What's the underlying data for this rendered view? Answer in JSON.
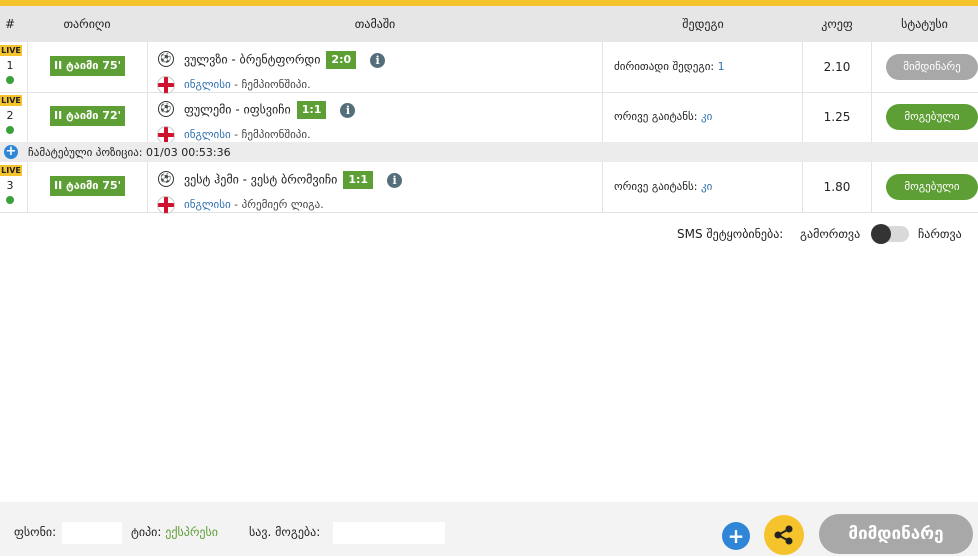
{
  "colors": {
    "accent_yellow": "#f5c32c",
    "badge_green": "#5d9e35",
    "status_grey": "#a8a8a8",
    "link_blue": "#2f6fb0",
    "plus_blue": "#2f86d6"
  },
  "header": {
    "col_num": "#",
    "col_date": "თარიღი",
    "col_match": "თამაში",
    "col_result": "შედეგი",
    "col_coef": "კოეფ",
    "col_status": "სტატუსი"
  },
  "rows": [
    {
      "live": "LIVE",
      "num": "1",
      "time": "II ტაიმი 75'",
      "teams": "ვულვზი - ბრენტფორდი",
      "score": "2:0",
      "country": "ინგლისი",
      "league": " - ჩემპიონშიპი.",
      "result_label": "ძირითადი შედეგი: ",
      "result_value": "1",
      "coef": "2.10",
      "status": "მიმდინარე",
      "status_color": "grey"
    },
    {
      "live": "LIVE",
      "num": "2",
      "time": "II ტაიმი 72'",
      "teams": "ფულემი - იფსვიჩი",
      "score": "1:1",
      "country": "ინგლისი",
      "league": " - ჩემპიონშიპი.",
      "result_label": "ორივე გაიტანს: ",
      "result_value": "კი",
      "coef": "1.25",
      "status": "მოგებული",
      "status_color": "green"
    },
    {
      "live": "LIVE",
      "num": "3",
      "time": "II ტაიმი 75'",
      "teams": "ვესტ ჰემი - ვესტ ბრომვიჩი",
      "score": "1:1",
      "country": "ინგლისი",
      "league": " - პრემიერ ლიგა.",
      "result_label": "ორივე გაიტანს: ",
      "result_value": "კი",
      "coef": "1.80",
      "status": "მოგებული",
      "status_color": "green"
    }
  ],
  "saved_position": {
    "label": "ჩამატებული პოზიცია:",
    "datetime": "01/03 00:53:36"
  },
  "sms": {
    "label": "SMS შეტყობინება:",
    "off": "გამორთვა",
    "on": "ჩართვა",
    "state": "off"
  },
  "footer": {
    "stake_label": "ფსონი:",
    "type_label": "ტიპი:",
    "type_value": "ექსპრესი",
    "total_win_label": "სავ. მოგება:",
    "current_button": "მიმდინარე"
  }
}
